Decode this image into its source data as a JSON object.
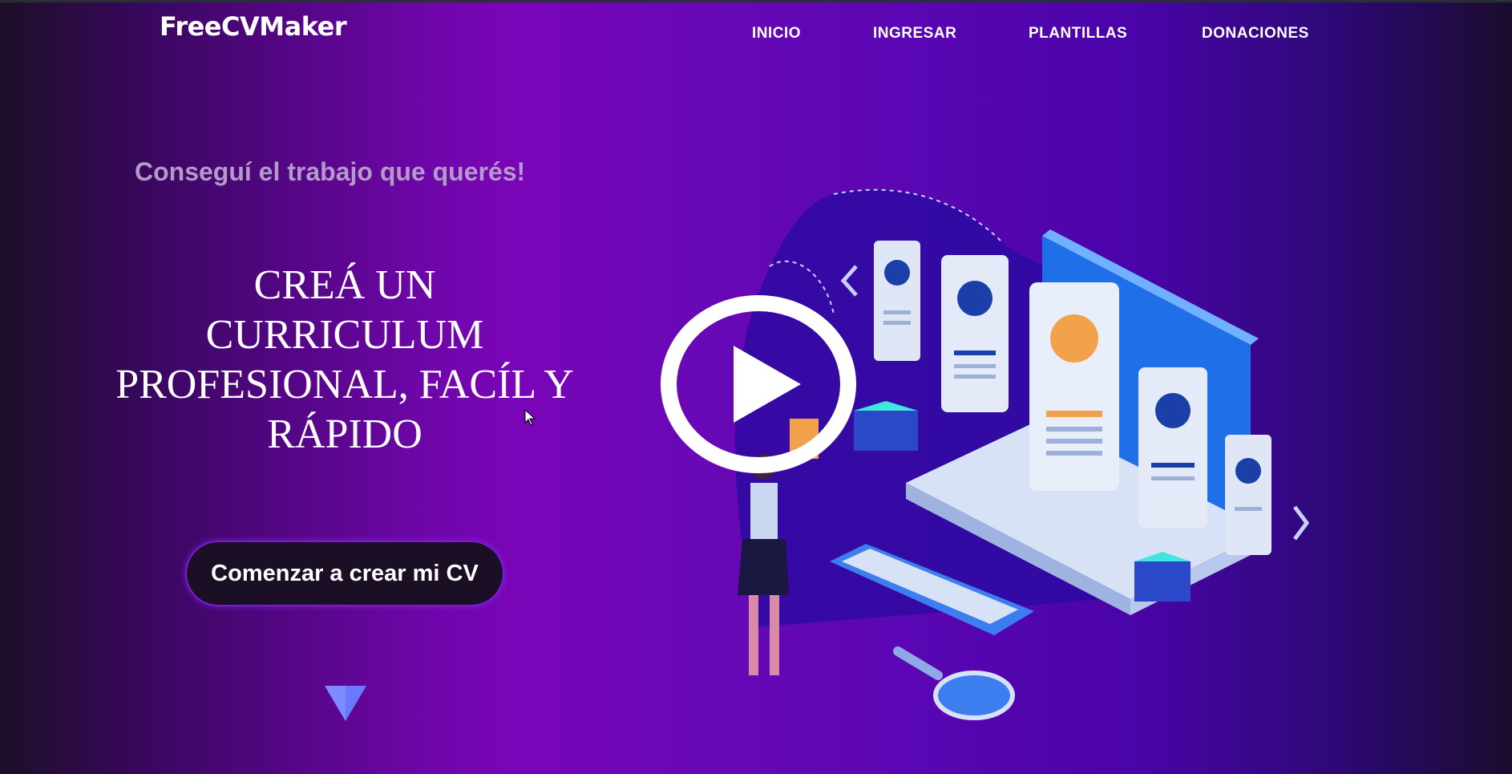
{
  "header": {
    "logo": "FreeCVMaker",
    "nav": [
      {
        "label": "INICIO"
      },
      {
        "label": "INGRESAR"
      },
      {
        "label": "PLANTILLAS"
      },
      {
        "label": "DONACIONES"
      }
    ]
  },
  "hero": {
    "tagline": "Conseguí el trabajo que querés!",
    "headline_lines": [
      "CREÁ UN",
      "CURRICULUM",
      "PROFESIONAL, FACÍL Y",
      "RÁPIDO"
    ],
    "cta_label": "Comenzar a crear mi CV"
  },
  "icons": {
    "scroll": "chevron-down-triangle-icon",
    "video": "play-icon"
  },
  "colors": {
    "accent": "#7a1ad8",
    "tagline": "#b49ac8",
    "button_bg": "#1b0f26",
    "scroll_icon": "#6a7aff"
  }
}
